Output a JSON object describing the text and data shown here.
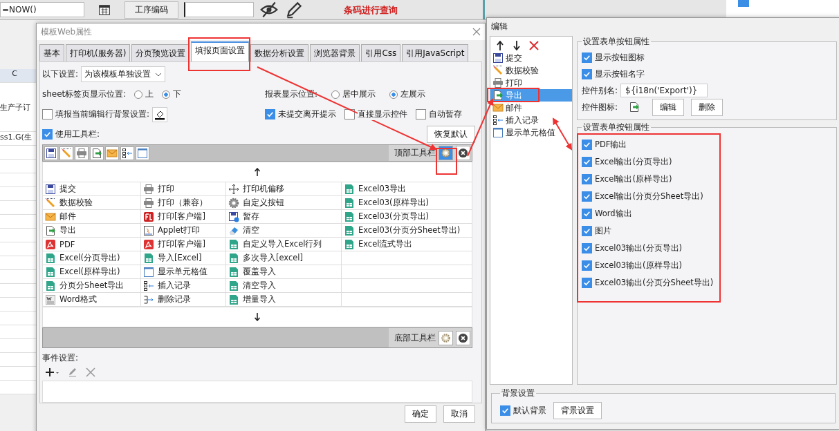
{
  "background_app": {
    "formula": "=NOW()",
    "field_label": "工序编码",
    "note": "条码进行查询",
    "column_header": "C",
    "cells": [
      "生产子订",
      "ss1.G(生"
    ]
  },
  "template_dialog": {
    "title": "模板Web属性",
    "tabs": [
      {
        "label": "基本",
        "selected": false
      },
      {
        "label": "打印机(服务器)",
        "selected": false
      },
      {
        "label": "分页预览设置",
        "selected": false
      },
      {
        "label": "填报页面设置",
        "selected": true
      },
      {
        "label": "数据分析设置",
        "selected": false
      },
      {
        "label": "浏览器背景",
        "selected": false
      },
      {
        "label": "引用Css",
        "selected": false
      },
      {
        "label": "引用JavaScript",
        "selected": false
      }
    ],
    "scope": {
      "label": "以下设置:",
      "value": "为该模板单独设置"
    },
    "sheet_position": {
      "label": "sheet标签页显示位置:",
      "options": [
        {
          "label": "上",
          "selected": false
        },
        {
          "label": "下",
          "selected": true
        }
      ]
    },
    "report_position": {
      "label": "报表显示位置:",
      "options": [
        {
          "label": "居中展示",
          "selected": false
        },
        {
          "label": "左展示",
          "selected": true
        }
      ]
    },
    "row_background": {
      "label": "填报当前编辑行背景设置:",
      "checked": false
    },
    "options": [
      {
        "label": "未提交离开提示",
        "checked": true
      },
      {
        "label": "直接显示控件",
        "checked": false
      },
      {
        "label": "自动暂存",
        "checked": false
      }
    ],
    "use_toolbar": {
      "label": "使用工具栏:",
      "checked": true
    },
    "restore_button": "恢复默认",
    "top_toolbar": {
      "label": "顶部工具栏",
      "buttons": [
        {
          "kind": "save"
        },
        {
          "kind": "validate"
        },
        {
          "kind": "print"
        },
        {
          "kind": "export"
        },
        {
          "kind": "mail"
        },
        {
          "kind": "insert"
        },
        {
          "kind": "cell"
        }
      ]
    },
    "button_columns": [
      [
        {
          "kind": "save",
          "label": "提交"
        },
        {
          "kind": "validate",
          "label": "数据校验"
        },
        {
          "kind": "mail",
          "label": "邮件"
        },
        {
          "kind": "export",
          "label": "导出"
        },
        {
          "kind": "pdf",
          "label": "PDF"
        },
        {
          "kind": "excel",
          "label": "Excel(分页导出)"
        },
        {
          "kind": "excel",
          "label": "Excel(原样导出)"
        },
        {
          "kind": "excel",
          "label": "分页分Sheet导出"
        },
        {
          "kind": "word",
          "label": "Word格式"
        }
      ],
      [
        {
          "kind": "print",
          "label": "打印"
        },
        {
          "kind": "print",
          "label": "打印（兼容）"
        },
        {
          "kind": "clientprint",
          "label": "打印[客户端]"
        },
        {
          "kind": "applet",
          "label": "Applet打印"
        },
        {
          "kind": "pdf",
          "label": "打印[客户端]"
        },
        {
          "kind": "excel",
          "label": "导入[Excel]"
        },
        {
          "kind": "cell",
          "label": "显示单元格值"
        },
        {
          "kind": "insert",
          "label": "插入记录"
        },
        {
          "kind": "delete",
          "label": "删除记录"
        }
      ],
      [
        {
          "kind": "move",
          "label": "打印机偏移"
        },
        {
          "kind": "gear",
          "label": "自定义按钮"
        },
        {
          "kind": "savetime",
          "label": "暂存"
        },
        {
          "kind": "eraser",
          "label": "清空"
        },
        {
          "kind": "excel",
          "label": "自定义导入Excel行列"
        },
        {
          "kind": "excel",
          "label": "多次导入[excel]"
        },
        {
          "kind": "excel",
          "label": "覆盖导入"
        },
        {
          "kind": "excel",
          "label": "清空导入"
        },
        {
          "kind": "excel",
          "label": "增量导入"
        }
      ],
      [
        {
          "kind": "excel",
          "label": "Excel03导出"
        },
        {
          "kind": "excel",
          "label": "Excel03(原样导出)"
        },
        {
          "kind": "excel",
          "label": "Excel03(分页导出)"
        },
        {
          "kind": "excel",
          "label": "Excel03(分页分Sheet导出)"
        },
        {
          "kind": "excel",
          "label": "Excel流式导出"
        }
      ]
    ],
    "bottom_toolbar": {
      "label": "底部工具栏"
    },
    "events_label": "事件设置:",
    "buttons": [
      "确定",
      "取消"
    ]
  },
  "edit_dialog": {
    "title": "编辑",
    "items": [
      {
        "kind": "save",
        "label": "提交",
        "selected": false
      },
      {
        "kind": "validate",
        "label": "数据校验",
        "selected": false
      },
      {
        "kind": "print",
        "label": "打印",
        "selected": false
      },
      {
        "kind": "export",
        "label": "导出",
        "selected": true
      },
      {
        "kind": "mail",
        "label": "邮件",
        "selected": false
      },
      {
        "kind": "insert",
        "label": "插入记录",
        "selected": false
      },
      {
        "kind": "cell",
        "label": "显示单元格值",
        "selected": false
      }
    ],
    "button_group": {
      "title": "设置表单按钮属性",
      "checks": [
        {
          "label": "显示按钮图标",
          "checked": true
        },
        {
          "label": "显示按钮名字",
          "checked": true
        }
      ],
      "alias_label": "控件别名:",
      "alias_value": "${i18n('Export')}",
      "icon_label": "控件图标:",
      "icon_buttons": [
        "编辑",
        "删除"
      ]
    },
    "export_group": {
      "title": "设置表单按钮属性",
      "checks": [
        {
          "label": "PDF输出",
          "checked": true
        },
        {
          "label": "Excel输出(分页导出)",
          "checked": true
        },
        {
          "label": "Excel输出(原样导出)",
          "checked": true
        },
        {
          "label": "Excel输出(分页分Sheet导出)",
          "checked": true
        },
        {
          "label": "Word输出",
          "checked": true
        },
        {
          "label": "图片",
          "checked": true
        },
        {
          "label": "Excel03输出(分页导出)",
          "checked": true
        },
        {
          "label": "Excel03输出(原样导出)",
          "checked": true
        },
        {
          "label": "Excel03输出(分页分Sheet导出)",
          "checked": true
        }
      ]
    },
    "background_group": {
      "title": "背景设置",
      "default": {
        "label": "默认背景",
        "checked": true
      },
      "button": "背景设置"
    }
  }
}
